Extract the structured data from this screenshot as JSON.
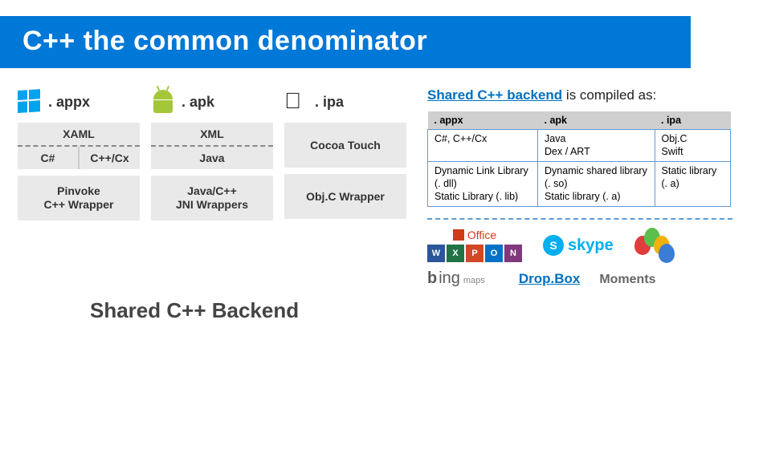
{
  "title": "C++ the common denominator",
  "platforms": {
    "windows": {
      "ext": ". appx",
      "ui_top": "XAML",
      "ui_left": "C#",
      "ui_right": "C++/Cx",
      "wrap_l1": "Pinvoke",
      "wrap_l2": "C++ Wrapper"
    },
    "android": {
      "ext": ". apk",
      "ui_top": "XML",
      "ui_bot": "Java",
      "wrap_l1": "Java/C++",
      "wrap_l2": "JNI Wrappers"
    },
    "apple": {
      "ext": ". ipa",
      "ui": "Cocoa Touch",
      "wrap": "Obj.C Wrapper"
    }
  },
  "shared_label": "Shared C++ Backend",
  "compiled_title_pre": "Shared C++ backend",
  "compiled_title_post": " is compiled as:",
  "table": {
    "h1": ". appx",
    "h2": ". apk",
    "h3": ". ipa",
    "r1c1": "C#, C++/Cx",
    "r1c2": "Java\nDex / ART",
    "r1c3": "Obj.C\nSwift",
    "r2c1": "Dynamic Link Library (. dll)\nStatic Library (. lib)",
    "r2c2": "Dynamic shared library (. so)\nStatic library (. a)",
    "r2c3": "Static library (. a)"
  },
  "logos": {
    "office": "Office",
    "tiles": [
      "W",
      "X",
      "P",
      "O",
      "N"
    ],
    "tile_colors": [
      "#2b579a",
      "#217346",
      "#d24726",
      "#0072c6",
      "#80397b"
    ],
    "skype": "skype",
    "bing_b": "b",
    "bing_rest": "ing",
    "bing_sub": "maps",
    "dropbox": "Drop.Box",
    "moments": "Moments"
  }
}
